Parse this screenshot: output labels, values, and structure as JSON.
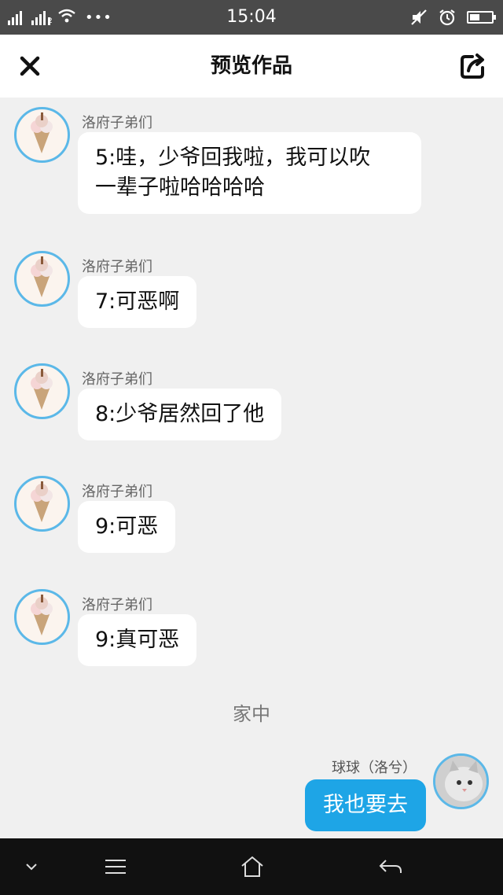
{
  "status_bar": {
    "time": "15:04",
    "sim_label": "2"
  },
  "header": {
    "title": "预览作品"
  },
  "messages": [
    {
      "sender": "洛府子弟们",
      "text_line1": "5:哇，少爷回我啦，我可以吹",
      "text_line2": "一辈子啦哈哈哈哈"
    },
    {
      "sender": "洛府子弟们",
      "text": "7:可恶啊"
    },
    {
      "sender": "洛府子弟们",
      "text": "8:少爷居然回了他"
    },
    {
      "sender": "洛府子弟们",
      "text": "9:可恶"
    },
    {
      "sender": "洛府子弟们",
      "text": "9:真可恶"
    }
  ],
  "location_label": "家中",
  "my_message": {
    "sender": "球球（洛兮）",
    "text": "我也要去"
  },
  "colors": {
    "accent": "#1ea5e6",
    "avatar_ring": "#5bb8e8",
    "status_bar": "#4a4a4a",
    "background": "#f0f0f0"
  },
  "icons": {
    "close": "close-icon",
    "share": "share-icon",
    "nav_down": "chevron-down-icon",
    "nav_menu": "menu-icon",
    "nav_home": "home-icon",
    "nav_back": "back-icon"
  }
}
